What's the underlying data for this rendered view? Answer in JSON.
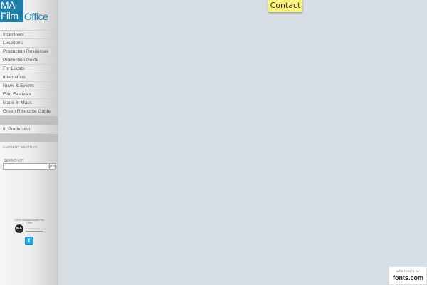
{
  "logo": {
    "line1": "MA",
    "line2": "Film",
    "line3": "Office"
  },
  "nav": {
    "items": [
      "Incentives",
      "Locations",
      "Production Resources",
      "Production Guide",
      "For Locals",
      "Internships",
      "News & Events",
      "Film Festivals",
      "Made In Mass",
      "Green Resource Guide"
    ],
    "in_production": "In Production"
  },
  "weather": {
    "label": "CURRENT WEATHER"
  },
  "search": {
    "label": "SEARCH (?)",
    "value": "",
    "go_label": "GO"
  },
  "footer": {
    "copyright": "©2012 Massachusetts Film Office",
    "ma_badge": "MA",
    "partner_logo": "massachusetts",
    "twitter_glyph": "t"
  },
  "contact": {
    "label": "Contact"
  },
  "webfonts": {
    "label": "WEB FONTS BY",
    "brand": "fonts.com"
  },
  "colors": {
    "background": "#d6dde3",
    "logo_blue": "#1f7fa7",
    "contact_yellow": "#fbf27a",
    "twitter_blue": "#29a9df"
  },
  "icons": [
    "ma-film-office-logo",
    "ma-badge-icon",
    "twitter-icon"
  ]
}
